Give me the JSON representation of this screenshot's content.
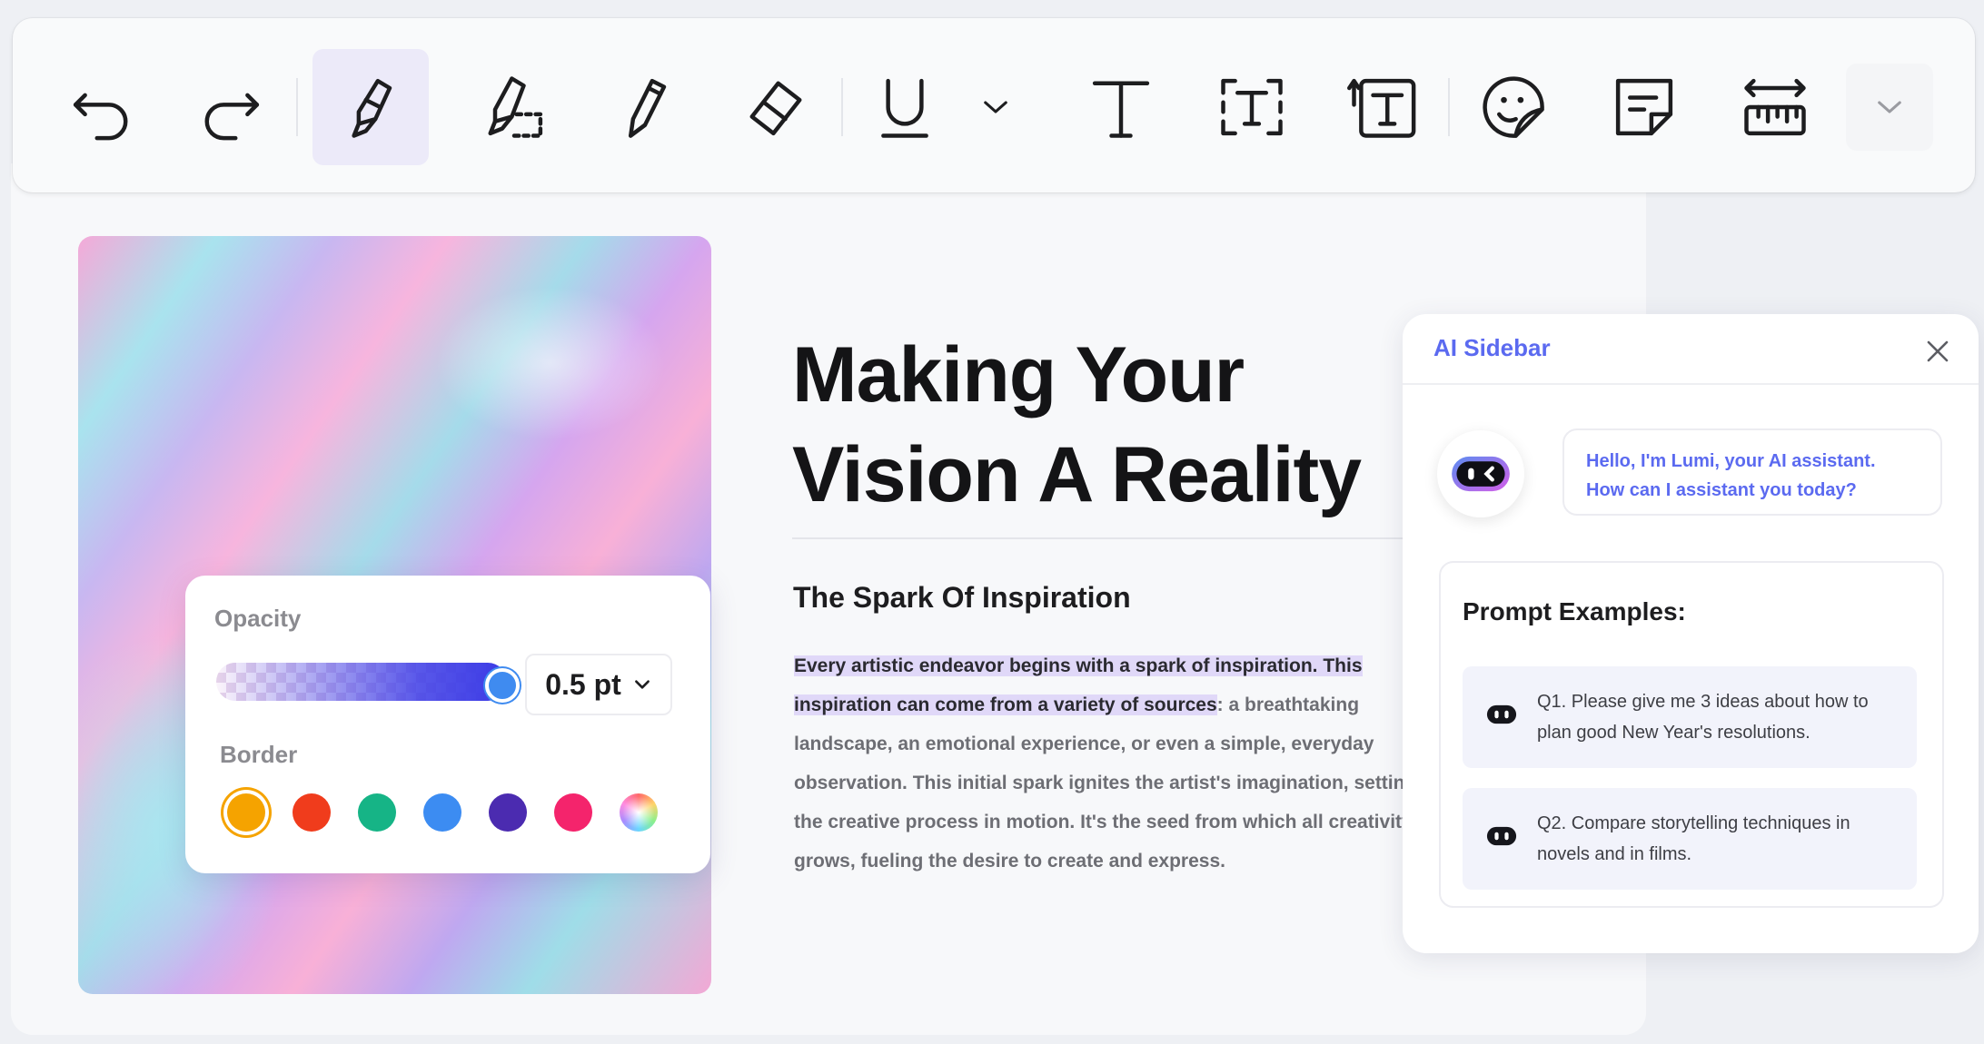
{
  "document": {
    "title_line1": "Making Your",
    "title_line2": "Vision A Reality",
    "subheading": "The Spark Of Inspiration",
    "para_highlight": "Every artistic endeavor begins with a spark of inspiration. This inspiration can come from a variety of sources",
    "para_rest": ": a breathtaking landscape, an emotional experience, or even a simple, everyday observation. This initial spark ignites the artist's imagination, setting the creative process in motion. It's the seed from which all creativity grows, fueling the desire to create and express."
  },
  "opacity_panel": {
    "opacity_label": "Opacity",
    "opacity_level": 0.95,
    "size_value": "0.5 pt",
    "border_label": "Border",
    "border_colors": [
      "#f5a300",
      "#f03c1c",
      "#16b486",
      "#3c8cf2",
      "#4b2bb0",
      "#f4246c",
      "rainbow"
    ],
    "selected_color": "#f5a300"
  },
  "ai_sidebar": {
    "title": "AI Sidebar",
    "greeting_line1": "Hello, I'm Lumi, your AI assistant.",
    "greeting_line2": "How can I assistant you today?",
    "prompts_title": "Prompt Examples:",
    "prompts": [
      "Q1. Please give me 3 ideas about how to plan good New Year's resolutions.",
      "Q2. Compare storytelling techniques in novels and in films."
    ]
  },
  "toolbar": {
    "tools": [
      "undo-icon",
      "redo-icon",
      "highlighter-icon",
      "area-highlighter-icon",
      "pencil-icon",
      "eraser-icon",
      "underline-icon",
      "chevron-down-icon",
      "text-icon",
      "textbox-icon",
      "text-callout-icon",
      "sticker-icon",
      "sticky-note-icon",
      "measure-icon",
      "chevron-down-icon"
    ],
    "active_tool": "highlighter-icon"
  },
  "colors": {
    "accent": "#5b6af0",
    "highlight": "#e0d8f8"
  }
}
